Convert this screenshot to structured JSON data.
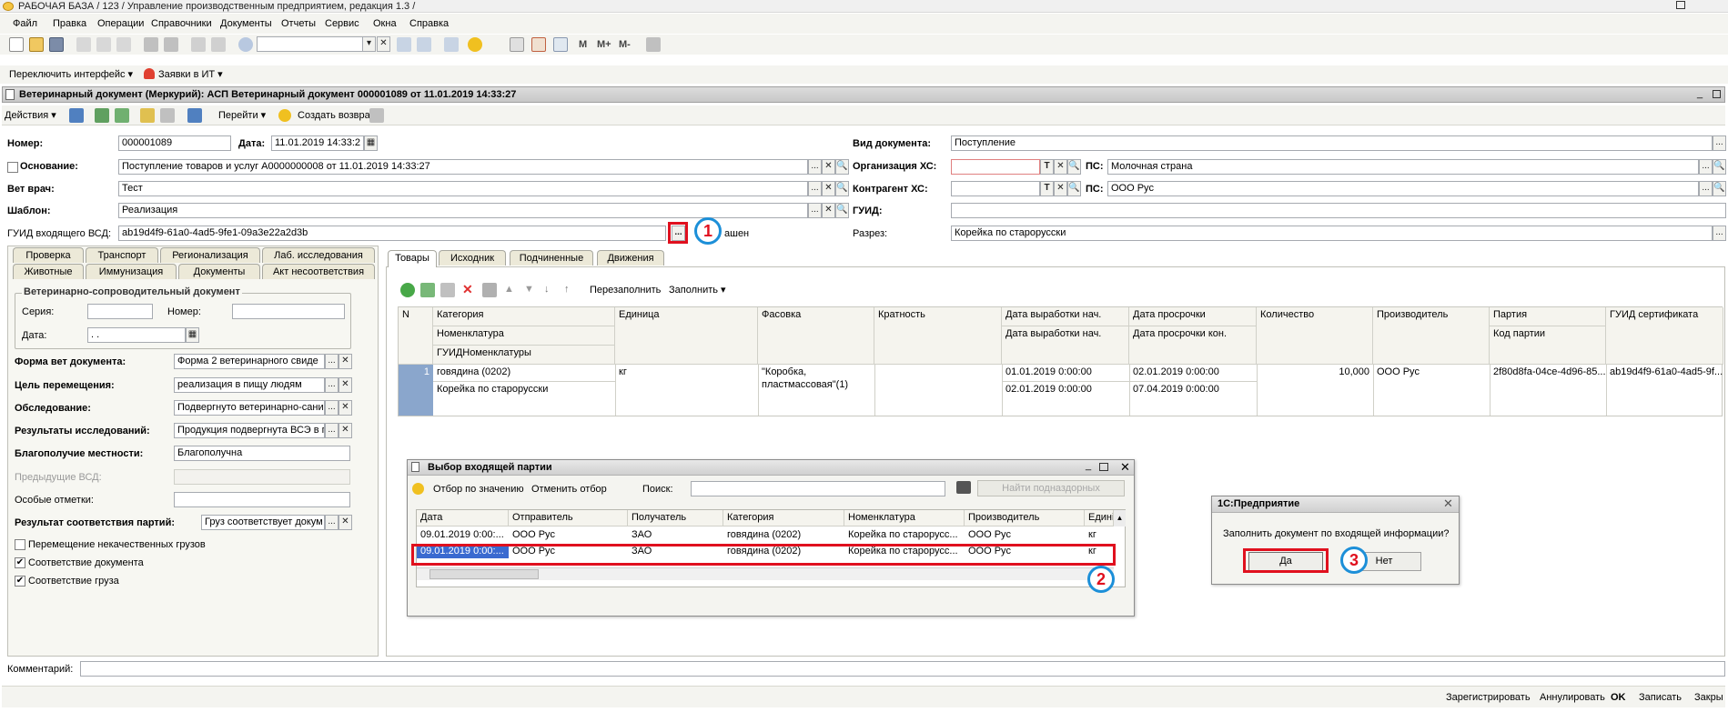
{
  "window": {
    "title": "РАБОЧАЯ БАЗА / 123 / Управление производственным предприятием, редакция 1.3 /"
  },
  "menu": [
    "Файл",
    "Правка",
    "Операции",
    "Справочники",
    "Документы",
    "Отчеты",
    "Сервис",
    "Окна",
    "Справка"
  ],
  "toolbar": {
    "m": "M",
    "m_plus": "M+",
    "m_minus": "M-",
    "switch_interface": "Переключить интерфейс ▾",
    "it_requests": "Заявки в ИТ ▾"
  },
  "document": {
    "title": "Ветеринарный документ (Меркурий): АСП Ветеринарный документ 000001089 от 11.01.2019 14:33:27"
  },
  "commands": {
    "actions": "Действия ▾",
    "goto": "Перейти ▾",
    "create_return": "Создать возврат"
  },
  "header": {
    "number_label": "Номер:",
    "number": "000001089",
    "date_label": "Дата:",
    "date": "11.01.2019 14:33:2",
    "basis_label": "Основание:",
    "basis": "Поступление товаров и услуг А0000000008 от 11.01.2019 14:33:27",
    "vet_label": "Вет врач:",
    "vet": "Тест",
    "template_label": "Шаблон:",
    "template": "Реализация",
    "incoming_guid_label": "ГУИД входящего ВСД:",
    "incoming_guid": "ab19d4f9-61a0-4ad5-9fe1-09a3e22a2d3b",
    "incoming_guid_status": "ашен",
    "doc_kind_label": "Вид документа:",
    "doc_kind": "Поступление",
    "org_hs_label": "Организация ХС:",
    "ps_label": "ПС:",
    "org_ps": "Молочная страна",
    "counterparty_hs_label": "Контрагент ХС:",
    "counterparty_ps": "ООО Рус",
    "guid_label": "ГУИД:",
    "cut_label": "Разрез:",
    "cut": "Корейка по старорусски"
  },
  "left_tabs_row1": [
    "Проверка",
    "Транспорт",
    "Регионализация",
    "Лаб. исследования"
  ],
  "left_tabs_row2": [
    "Животные",
    "Иммунизация",
    "Документы",
    "Акт несоответствия"
  ],
  "left_panel": {
    "group_title": "Ветеринарно-сопроводительный документ",
    "series_label": "Серия:",
    "number_label": "Номер:",
    "date_label": "Дата:",
    "date_value": " .  .",
    "form_label": "Форма вет документа:",
    "form_value": "Форма 2 ветеринарного свиде",
    "purpose_label": "Цель перемещения:",
    "purpose_value": "реализация в пищу людям",
    "inspection_label": "Обследование:",
    "inspection_value": "Подвергнуто ветеринарно-сани",
    "research_label": "Результаты исследований:",
    "research_value": "Продукция подвергнута ВСЭ в г",
    "wellbeing_label": "Благополучие местности:",
    "wellbeing_value": "Благополучна",
    "prev_vsd_label": "Предыдущие ВСД:",
    "special_marks_label": "Особые отметки:",
    "batch_result_label": "Результат соответствия партий:",
    "batch_result_value": "Груз соответствует докум",
    "checkbox_low_quality": "Перемещение некачественных грузов",
    "checkbox_doc_conformity": "Соответствие документа",
    "checkbox_cargo_conformity": "Соответствие груза"
  },
  "right_tabs": [
    "Товары",
    "Исходник",
    "Подчиненные",
    "Движения"
  ],
  "goods_toolbar": {
    "refill": "Перезаполнить",
    "fill": "Заполнить ▾"
  },
  "goods_table": {
    "headers": {
      "n": "N",
      "category": "Категория",
      "nomenclature": "Номенклатура",
      "nomenclature_guid": "ГУИДНоменклатуры",
      "unit": "Единица",
      "packaging": "Фасовка",
      "multiplicity": "Кратность",
      "prod_start": "Дата выработки нач.",
      "prod_start2": "Дата выработки нач.",
      "expiry_start": "Дата просрочки",
      "expiry_end": "Дата просрочки кон.",
      "quantity": "Количество",
      "producer": "Производитель",
      "batch": "Партия",
      "batch_code": "Код партии",
      "cert_guid": "ГУИД сертификата"
    },
    "row": {
      "n": "1",
      "category": "говядина (0202)",
      "nomenclature": "Корейка по старорусски",
      "unit": "кг",
      "packaging_line1": "\"Коробка,",
      "packaging_line2": "пластмассовая\"(1)",
      "prod_start": "01.01.2019 0:00:00",
      "prod_start2": "02.01.2019 0:00:00",
      "expiry_start": "02.01.2019 0:00:00",
      "expiry_end": "07.04.2019 0:00:00",
      "quantity": "10,000",
      "producer": "ООО Рус",
      "batch": "2f80d8fa-04ce-4d96-85...",
      "cert_guid": "ab19d4f9-61a0-4ad5-9f..."
    }
  },
  "batch_window": {
    "title": "Выбор входящей партии",
    "filter_by_value": "Отбор по значению",
    "cancel_filter": "Отменить отбор",
    "search_label": "Поиск:",
    "find_sub": "Найти подназдорных",
    "headers": [
      "Дата",
      "Отправитель",
      "Получатель",
      "Категория",
      "Номенклатура",
      "Производитель",
      "Едині"
    ],
    "rows": [
      [
        "09.01.2019 0:00:...",
        "ООО Рус",
        "ЗАО",
        "говядина (0202)",
        "Корейка по старорусс...",
        "ООО Рус",
        "кг"
      ],
      [
        "09.01.2019 0:00:...",
        "ООО Рус",
        "ЗАО",
        "говядина (0202)",
        "Корейка по старорусс...",
        "ООО Рус",
        "кг"
      ]
    ]
  },
  "dialog": {
    "title": "1С:Предприятие",
    "message": "Заполнить документ по входящей информации?",
    "yes": "Да",
    "no": "Нет"
  },
  "annotations": [
    "1",
    "2",
    "3"
  ],
  "footer": {
    "comment_label": "Комментарий:",
    "register": "Зарегистрировать",
    "annul": "Аннулировать",
    "ok": "OK",
    "save": "Записать",
    "close": "Закры"
  }
}
